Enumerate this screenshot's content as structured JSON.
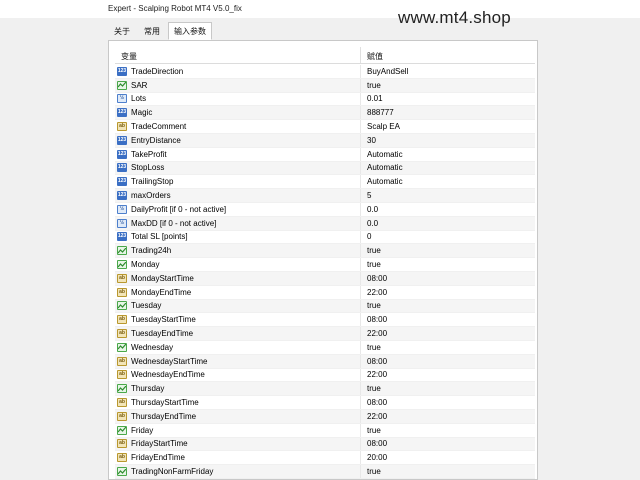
{
  "window": {
    "title": "Expert - Scalping Robot MT4 V5.0_fix"
  },
  "watermark": "www.mt4.shop",
  "tabs": [
    {
      "label": "关于",
      "active": false
    },
    {
      "label": "常用",
      "active": false
    },
    {
      "label": "输入参数",
      "active": true
    }
  ],
  "table": {
    "headers": {
      "variable": "变量",
      "value": "赋值"
    },
    "rows": [
      {
        "name": "TradeDirection",
        "value": "BuyAndSell",
        "type": "int",
        "icon": "enum-icon"
      },
      {
        "name": "SAR",
        "value": "true",
        "type": "bool",
        "icon": "bool-icon"
      },
      {
        "name": "Lots",
        "value": "0.01",
        "type": "double",
        "icon": "double-icon"
      },
      {
        "name": "Magic",
        "value": "888777",
        "type": "int",
        "icon": "int-icon"
      },
      {
        "name": "TradeComment",
        "value": "Scalp EA",
        "type": "string",
        "icon": "string-icon"
      },
      {
        "name": "EntryDistance",
        "value": "30",
        "type": "int",
        "icon": "int-icon"
      },
      {
        "name": "TakeProfit",
        "value": "Automatic",
        "type": "int",
        "icon": "enum-icon"
      },
      {
        "name": "StopLoss",
        "value": "Automatic",
        "type": "int",
        "icon": "enum-icon"
      },
      {
        "name": "TrailingStop",
        "value": "Automatic",
        "type": "int",
        "icon": "enum-icon"
      },
      {
        "name": "maxOrders",
        "value": "5",
        "type": "int",
        "icon": "int-icon"
      },
      {
        "name": "DailyProfit [if 0 - not active]",
        "value": "0.0",
        "type": "double",
        "icon": "double-icon"
      },
      {
        "name": "MaxDD [if 0 - not active]",
        "value": "0.0",
        "type": "double",
        "icon": "double-icon"
      },
      {
        "name": "Total SL [points]",
        "value": "0",
        "type": "int",
        "icon": "int-icon"
      },
      {
        "name": "Trading24h",
        "value": "true",
        "type": "bool",
        "icon": "bool-icon"
      },
      {
        "name": "Monday",
        "value": "true",
        "type": "bool",
        "icon": "bool-icon"
      },
      {
        "name": "MondayStartTime",
        "value": "08:00",
        "type": "string",
        "icon": "string-icon"
      },
      {
        "name": "MondayEndTime",
        "value": "22:00",
        "type": "string",
        "icon": "string-icon"
      },
      {
        "name": "Tuesday",
        "value": "true",
        "type": "bool",
        "icon": "bool-icon"
      },
      {
        "name": "TuesdayStartTime",
        "value": "08:00",
        "type": "string",
        "icon": "string-icon"
      },
      {
        "name": "TuesdayEndTime",
        "value": "22:00",
        "type": "string",
        "icon": "string-icon"
      },
      {
        "name": "Wednesday",
        "value": "true",
        "type": "bool",
        "icon": "bool-icon"
      },
      {
        "name": "WednesdayStartTime",
        "value": "08:00",
        "type": "string",
        "icon": "string-icon"
      },
      {
        "name": "WednesdayEndTime",
        "value": "22:00",
        "type": "string",
        "icon": "string-icon"
      },
      {
        "name": "Thursday",
        "value": "true",
        "type": "bool",
        "icon": "bool-icon"
      },
      {
        "name": "ThursdayStartTime",
        "value": "08:00",
        "type": "string",
        "icon": "string-icon"
      },
      {
        "name": "ThursdayEndTime",
        "value": "22:00",
        "type": "string",
        "icon": "string-icon"
      },
      {
        "name": "Friday",
        "value": "true",
        "type": "bool",
        "icon": "bool-icon"
      },
      {
        "name": "FridayStartTime",
        "value": "08:00",
        "type": "string",
        "icon": "string-icon"
      },
      {
        "name": "FridayEndTime",
        "value": "20:00",
        "type": "string",
        "icon": "string-icon"
      },
      {
        "name": "TradingNonFarmFriday",
        "value": "true",
        "type": "bool",
        "icon": "bool-icon"
      }
    ]
  }
}
